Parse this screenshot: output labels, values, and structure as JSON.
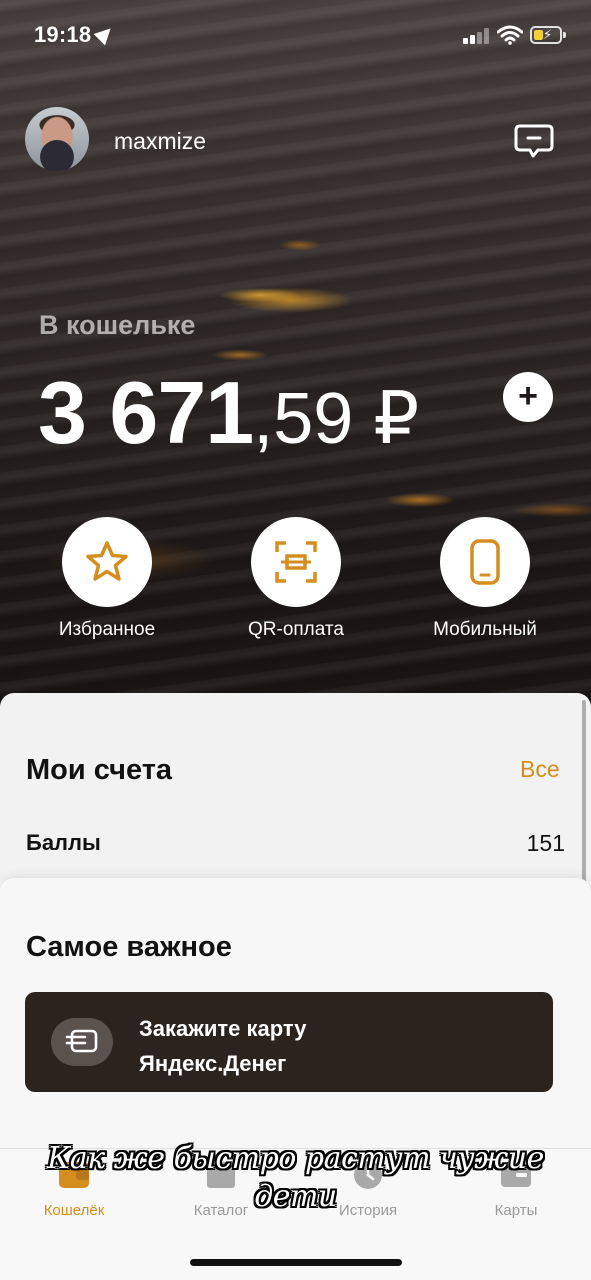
{
  "status_bar": {
    "time": "19:18",
    "icons": [
      "location-arrow-icon",
      "signal-icon",
      "wifi-icon",
      "battery-charging-icon"
    ]
  },
  "header": {
    "username": "maxmize",
    "avatar": "avatar",
    "chat_icon": "chat-bubble-icon"
  },
  "wallet": {
    "label": "В кошельке",
    "balance_whole": "3 671",
    "balance_fraction": ",59 ₽",
    "topup_symbol": "+"
  },
  "quick_actions": [
    {
      "label": "Избранное",
      "icon": "star-icon"
    },
    {
      "label": "QR-оплата",
      "icon": "qr-scan-icon"
    },
    {
      "label": "Мобильный",
      "icon": "phone-icon"
    }
  ],
  "accounts": {
    "title": "Мои счета",
    "all_link": "Все",
    "rows": [
      {
        "label": "Баллы",
        "value": "151"
      }
    ]
  },
  "important": {
    "title": "Самое важное",
    "promo": {
      "line1": "Закажите карту",
      "line2": "Яндекс.Денег",
      "icon": "card-icon"
    }
  },
  "tabbar": {
    "tabs": [
      {
        "label": "Кошелёк",
        "icon": "wallet-icon",
        "active": true
      },
      {
        "label": "Каталог",
        "icon": "catalog-icon",
        "active": false
      },
      {
        "label": "История",
        "icon": "clock-icon",
        "active": false
      },
      {
        "label": "Карты",
        "icon": "cards-icon",
        "active": false
      }
    ]
  },
  "caption": {
    "text": "Как же быстро растут чужие дети"
  },
  "colors": {
    "accent": "#d38e1f",
    "promo_bg": "#2b231e",
    "sheet_bg": "#f2f2f2"
  }
}
